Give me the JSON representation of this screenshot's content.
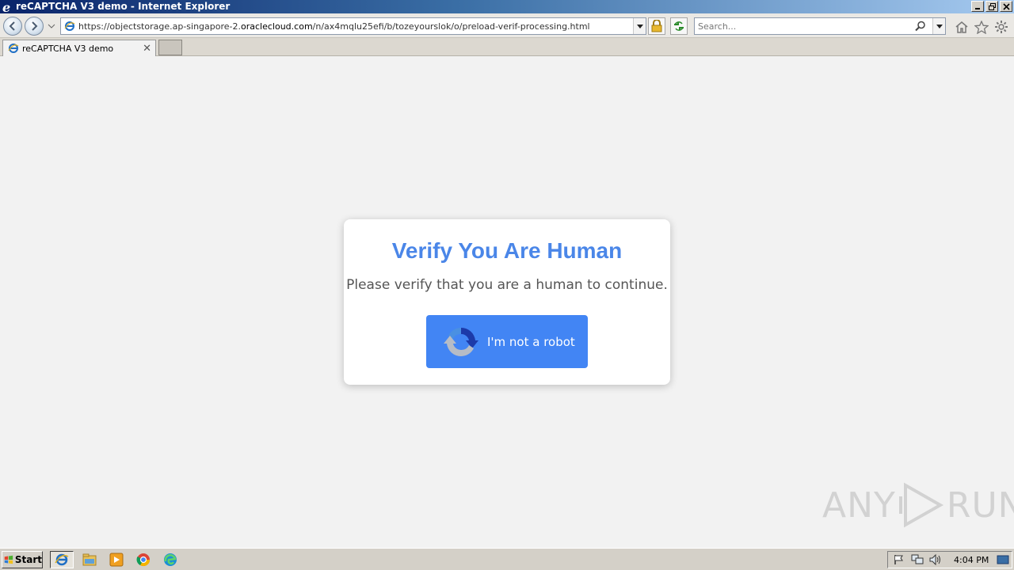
{
  "window": {
    "title": "reCAPTCHA V3 demo - Internet Explorer",
    "controls": [
      "minimize",
      "restore",
      "close"
    ]
  },
  "navbar": {
    "back_icon": "back-arrow-icon",
    "forward_icon": "forward-arrow-icon",
    "url_prefix": "https://objectstorage.ap-singapore-2.",
    "url_domain": "oraclecloud.com",
    "url_suffix": "/n/ax4mqlu25efi/b/tozeyourslok/o/preload-verif-processing.html",
    "search_placeholder": "Search..."
  },
  "tabs": [
    {
      "label": "reCAPTCHA V3 demo",
      "active": true
    }
  ],
  "page": {
    "heading": "Verify You Are Human",
    "message": "Please verify that you are a human to continue.",
    "button_label": "I'm not a robot",
    "accent_color": "#4285f4",
    "heading_color": "#4a86e8"
  },
  "watermark": {
    "left": "ANY",
    "right": "RUN"
  },
  "taskbar": {
    "start_label": "Start",
    "apps": [
      "internet-explorer-icon",
      "file-explorer-icon",
      "media-player-icon",
      "chrome-icon",
      "edge-icon"
    ],
    "tray_icons": [
      "flag-icon",
      "network-icon",
      "volume-icon"
    ],
    "clock": "4:04 PM"
  }
}
